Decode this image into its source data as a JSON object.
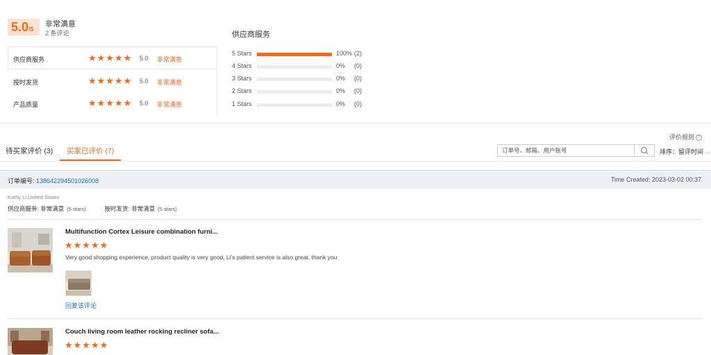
{
  "summary": {
    "score": "5.0",
    "score_denominator": "/5",
    "overall_label": "非常满意",
    "review_count": "2 条评论",
    "ratings": [
      {
        "label": "供应商服务",
        "stars": "★★★★★",
        "value": "5.0",
        "level": "非常满意"
      },
      {
        "label": "按时发货",
        "stars": "★★★★★",
        "value": "5.0",
        "level": "非常满意"
      },
      {
        "label": "产品质量",
        "stars": "★★★★★",
        "value": "5.0",
        "level": "非常满意"
      }
    ],
    "distribution_title": "供应商服务",
    "distribution": [
      {
        "label": "5  Stars",
        "percent": "100%",
        "count": "(2)",
        "fill": 1.0
      },
      {
        "label": "4  Stars",
        "percent": "0%",
        "count": "(0)",
        "fill": 0
      },
      {
        "label": "3  Stars",
        "percent": "0%",
        "count": "(0)",
        "fill": 0
      },
      {
        "label": "2  Stars",
        "percent": "0%",
        "count": "(0)",
        "fill": 0
      },
      {
        "label": "1  Stars",
        "percent": "0%",
        "count": "(0)",
        "fill": 0
      }
    ]
  },
  "toolbar": {
    "rules_link": "评价规则",
    "rules_icon": "?",
    "tabs": [
      {
        "label": "待买家评价 (3)"
      },
      {
        "label": "买家已评价 (7)"
      }
    ],
    "search_placeholder": "订单号、邮箱、用户账号",
    "sort_label": "排序：留评时间",
    "sort_chevron": "⌵"
  },
  "order": {
    "number_label": "订单编号:",
    "number": "138642294501026008",
    "time_created": "Time Created: 2023-03-02 00:37",
    "buyer": "Kathy Li,United States",
    "supplier_service_label": "供应商服务:",
    "supplier_service_value": "非常满意",
    "supplier_service_stars": "(5 stars)",
    "ontime_label": "按时发货:",
    "ontime_value": "非常满意",
    "ontime_stars": "(5 stars)",
    "products": [
      {
        "name": "Multifunction Cortex Leisure combination furni...",
        "stars": "★★★★★",
        "comment": "Very good shopping experience, product quality is very good, Li's patient service is also great, thank you",
        "reply_link": "回复该评论"
      },
      {
        "name": "Couch living room leather rocking recliner sofa...",
        "stars": "★★★★★"
      }
    ]
  },
  "colors": {
    "accent": "#f26b1d",
    "link": "#1a73c9",
    "header_bg": "#eceff3"
  },
  "icons": {
    "search": "search-icon",
    "help": "help-circle-icon",
    "star": "star-icon",
    "chevron": "chevron-down-icon"
  }
}
